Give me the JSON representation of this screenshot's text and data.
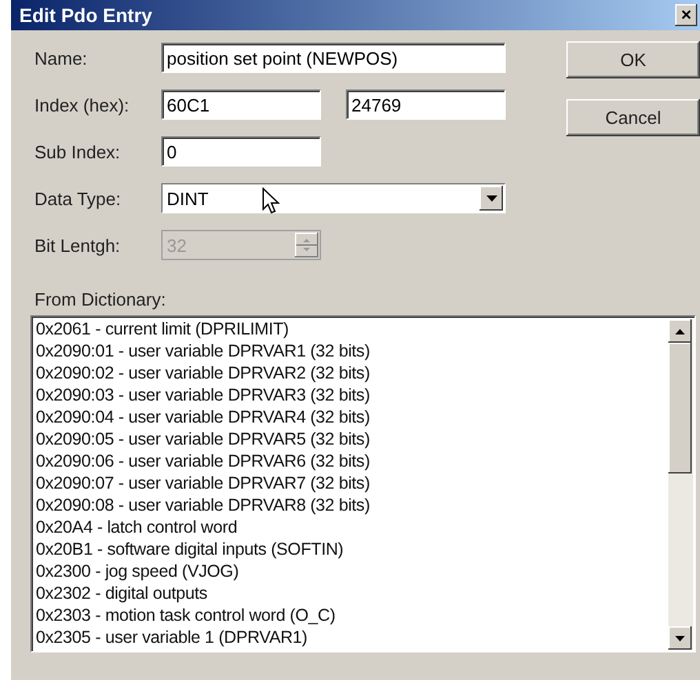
{
  "window": {
    "title": "Edit Pdo Entry",
    "close": "×"
  },
  "fields": [
    {
      "kind": "text",
      "label": "Name:",
      "value": "position set point (NEWPOS)"
    },
    {
      "kind": "pair",
      "label": "Index (hex):",
      "value": "60C1",
      "value_2": "24769"
    },
    {
      "kind": "text",
      "label": "Sub Index:",
      "value": "0"
    },
    {
      "kind": "combo",
      "label": "Data Type:",
      "value": "DINT"
    },
    {
      "kind": "spin",
      "label": "Bit Lentgh:",
      "value": "32",
      "disabled": true
    }
  ],
  "buttons": [
    "OK",
    "Cancel"
  ],
  "dictionary": {
    "label": "From Dictionary:",
    "items": [
      {
        "text": "0x2061 - current limit (DPRILIMIT)",
        "selected": false
      },
      {
        "text": "0x2090:01 - user variable DPRVAR1 (32 bits)",
        "selected": false
      },
      {
        "text": "0x2090:02 - user variable DPRVAR2 (32 bits)",
        "selected": false
      },
      {
        "text": "0x2090:03 - user variable DPRVAR3 (32 bits)",
        "selected": false
      },
      {
        "text": "0x2090:04 - user variable DPRVAR4 (32 bits)",
        "selected": false
      },
      {
        "text": "0x2090:05 - user variable DPRVAR5 (32 bits)",
        "selected": false
      },
      {
        "text": "0x2090:06 - user variable DPRVAR6 (32 bits)",
        "selected": false
      },
      {
        "text": "0x2090:07 - user variable DPRVAR7 (32 bits)",
        "selected": false
      },
      {
        "text": "0x2090:08 - user variable DPRVAR8 (32 bits)",
        "selected": false
      },
      {
        "text": "0x20A4 - latch control word",
        "selected": false
      },
      {
        "text": "0x20B1 - software digital inputs (SOFTIN)",
        "selected": false
      },
      {
        "text": "0x2300 - jog speed (VJOG)",
        "selected": false
      },
      {
        "text": "0x2302 - digital outputs",
        "selected": false
      },
      {
        "text": "0x2303 - motion task control word (O_C)",
        "selected": false
      },
      {
        "text": "0x2305 - user variable 1 (DPRVAR1)",
        "selected": false
      }
    ]
  }
}
